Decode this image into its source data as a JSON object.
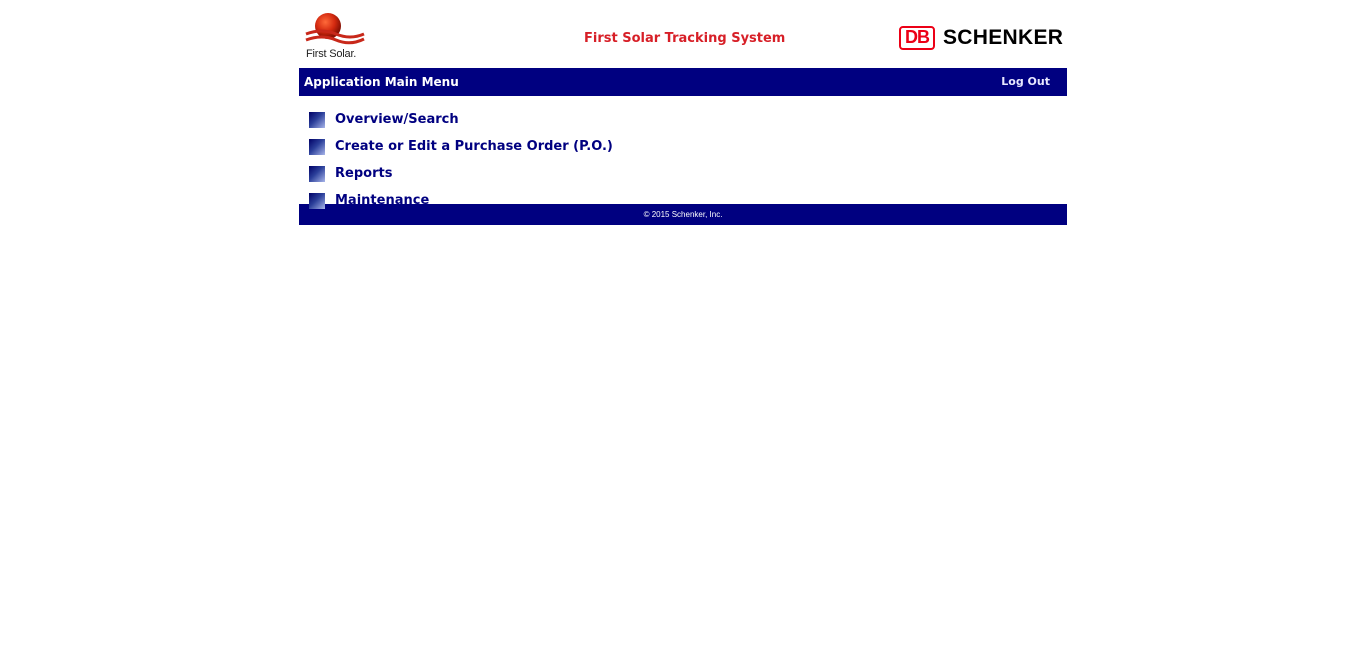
{
  "header": {
    "first_solar_logo_text": "First Solar.",
    "app_title": "First Solar Tracking System",
    "db_logo_text": "DB",
    "schenker_logo_text": "SCHENKER"
  },
  "menubar": {
    "title": "Application Main Menu",
    "logout_label": "Log Out"
  },
  "menu": {
    "items": [
      {
        "label": "Overview/Search"
      },
      {
        "label": "Create or Edit a Purchase Order (P.O.)"
      },
      {
        "label": "Reports"
      },
      {
        "label": "Maintenance"
      }
    ]
  },
  "footer": {
    "copyright": "© 2015 Schenker, Inc."
  },
  "colors": {
    "navy": "#000080",
    "title_red": "#d71f27",
    "db_red": "#ec0016"
  }
}
